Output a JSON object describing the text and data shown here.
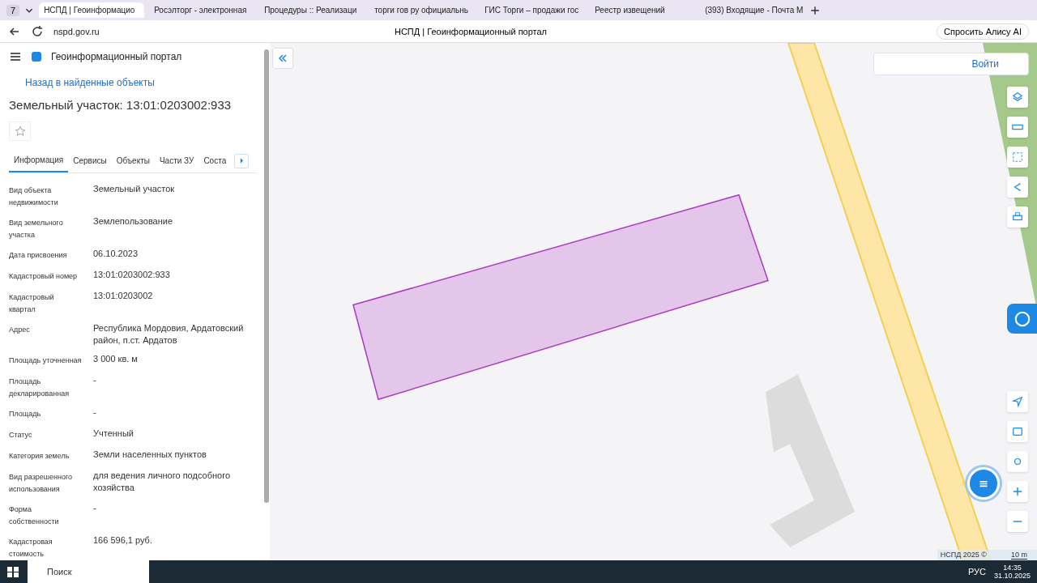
{
  "browser": {
    "tab_count": "7",
    "tabs": [
      {
        "title": "НСПД | Геоинформацио",
        "selected": true
      },
      {
        "title": "Росэлторг - электронная",
        "selected": false
      },
      {
        "title": "Процедуры :: Реализаци",
        "selected": false
      },
      {
        "title": "торги гов ру официальнь",
        "selected": false
      },
      {
        "title": "ГИС Торги – продажи гос",
        "selected": false
      },
      {
        "title": "Реестр извещений",
        "selected": false
      },
      {
        "title": "(393) Входящие - Почта М",
        "selected": false
      }
    ],
    "url": "nspd.gov.ru",
    "page_title": "НСПД | Геоинформационный портал",
    "alice": "Спросить Алису AI"
  },
  "panel": {
    "app_title": "Геоинформационный портал",
    "back_link": "Назад в найденные объекты",
    "heading": "Земельный участок: 13:01:0203002:933",
    "tabs": [
      {
        "label": "Информация",
        "selected": true
      },
      {
        "label": "Сервисы",
        "selected": false
      },
      {
        "label": "Объекты",
        "selected": false
      },
      {
        "label": "Части ЗУ",
        "selected": false
      },
      {
        "label": "Соста",
        "selected": false
      }
    ],
    "fields": [
      {
        "label": "Вид объекта недвижимости",
        "value": "Земельный участок"
      },
      {
        "label": "Вид земельного участка",
        "value": "Землепользование"
      },
      {
        "label": "Дата присвоения",
        "value": "06.10.2023"
      },
      {
        "label": "Кадастровый номер",
        "value": "13:01:0203002:933"
      },
      {
        "label": "Кадастровый квартал",
        "value": "13:01:0203002"
      },
      {
        "label": "Адрес",
        "value": "Республика Мордовия, Ардатовский район, п.ст. Ардатов"
      },
      {
        "label": "Площадь уточненная",
        "value": "3 000 кв. м"
      },
      {
        "label": "Площадь декларированная",
        "value": "-"
      },
      {
        "label": "Площадь",
        "value": "-"
      },
      {
        "label": "Статус",
        "value": "Учтенный"
      },
      {
        "label": "Категория земель",
        "value": "Земли населенных пунктов"
      },
      {
        "label": "Вид разрешенного использования",
        "value": "для ведения личного подсобного хозяйства"
      },
      {
        "label": "Форма собственности",
        "value": "-"
      },
      {
        "label": "Кадастровая стоимость",
        "value": "166 596,1 руб."
      }
    ]
  },
  "map": {
    "login": "Войти",
    "attribution": "НСПД 2025 ©",
    "scale": "10 m"
  },
  "taskbar": {
    "search": "Поиск",
    "time": "14:35",
    "date": "31.10.2025",
    "lang": "РУС"
  }
}
